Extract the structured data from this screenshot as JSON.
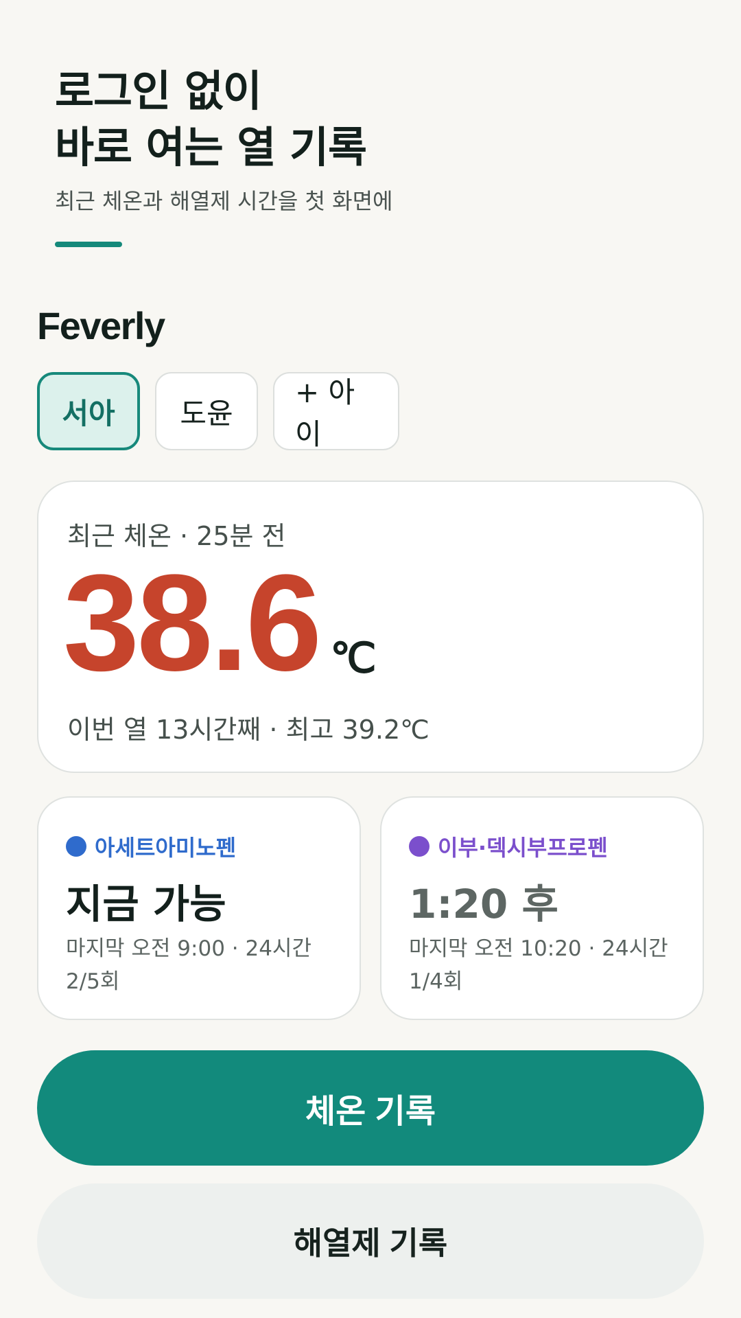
{
  "hero": {
    "title_line1": "로그인 없이",
    "title_line2": "바로 여는 열 기록",
    "subtitle": "최근 체온과 해열제 시간을 첫 화면에"
  },
  "app": {
    "brand": "Feverly"
  },
  "children": {
    "items": [
      {
        "label": "서아",
        "selected": true
      },
      {
        "label": "도윤",
        "selected": false
      },
      {
        "label": "+ 아이",
        "selected": false
      }
    ]
  },
  "temperature": {
    "meta": "최근 체온 · 25분 전",
    "value": "38.6",
    "unit": "℃",
    "footer": "이번 열 13시간째 · 최고 39.2℃",
    "value_color": "#c6442c"
  },
  "medications": [
    {
      "name": "아세트아미노펜",
      "color": "#2f6bcc",
      "status": "지금 가능",
      "status_color": "#13201c",
      "last": "마지막 오전 9:00 · 24시간",
      "count": "2/5회"
    },
    {
      "name": "이부·덱시부프로펜",
      "color": "#7b4fcc",
      "status": "1:20 후",
      "status_color": "#5d6663",
      "last": "마지막 오전 10:20 · 24시간",
      "count": "1/4회"
    }
  ],
  "actions": {
    "record_temperature": "체온 기록",
    "record_medication": "해열제 기록"
  },
  "colors": {
    "accent": "#128a7c",
    "background": "#f8f7f3"
  }
}
